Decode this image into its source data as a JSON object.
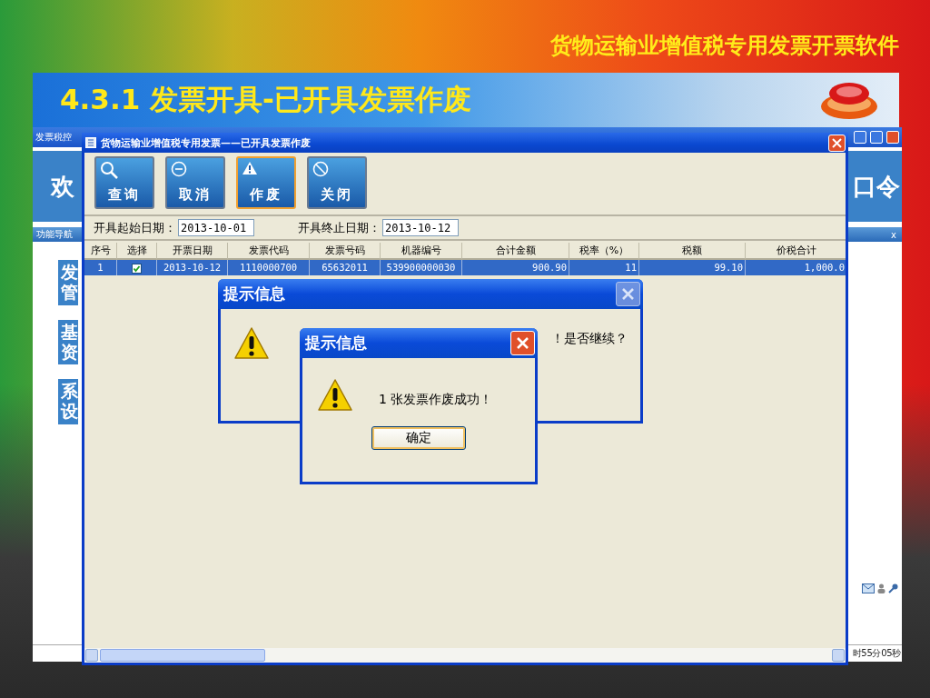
{
  "slide": {
    "subtitle": "货物运输业增值税专用发票开票软件",
    "heading": "4.3.1 发票开具-已开具发票作废"
  },
  "background_app": {
    "title": "发票税控",
    "banner_left": "欢",
    "banner_right": "口令",
    "nav_header": "功能导航",
    "nav_close": "x",
    "nav_tiles": [
      "发管",
      "基资",
      "系设"
    ],
    "status_time": "时55分05秒"
  },
  "main_window": {
    "title": "货物运输业增值税专用发票——已开具发票作废",
    "toolbar": [
      {
        "label": "查询",
        "kind": "search",
        "selected": false
      },
      {
        "label": "取消",
        "kind": "minus",
        "selected": false
      },
      {
        "label": "作废",
        "kind": "warning",
        "selected": true
      },
      {
        "label": "关闭",
        "kind": "forbid",
        "selected": false
      }
    ],
    "start_label": "开具起始日期：",
    "start_value": "2013-10-01",
    "end_label": "开具终止日期：",
    "end_value": "2013-10-12",
    "table": {
      "columns": [
        "序号",
        "选择",
        "开票日期",
        "发票代码",
        "发票号码",
        "机器编号",
        "合计金额",
        "税率（%）",
        "税额",
        "价税合计"
      ],
      "rows": [
        {
          "selected": true,
          "checked": true,
          "cells": [
            "1",
            "",
            "2013-10-12",
            "1110000700",
            "65632011",
            "539900000030",
            "900.90",
            "11",
            "99.10",
            "1,000.0"
          ]
        }
      ]
    }
  },
  "dialogs": [
    {
      "title": "提示信息",
      "message": "！是否继续？",
      "close_enabled": false
    },
    {
      "title": "提示信息",
      "message": "1 张发票作废成功！",
      "close_enabled": true,
      "button": "确定"
    }
  ]
}
